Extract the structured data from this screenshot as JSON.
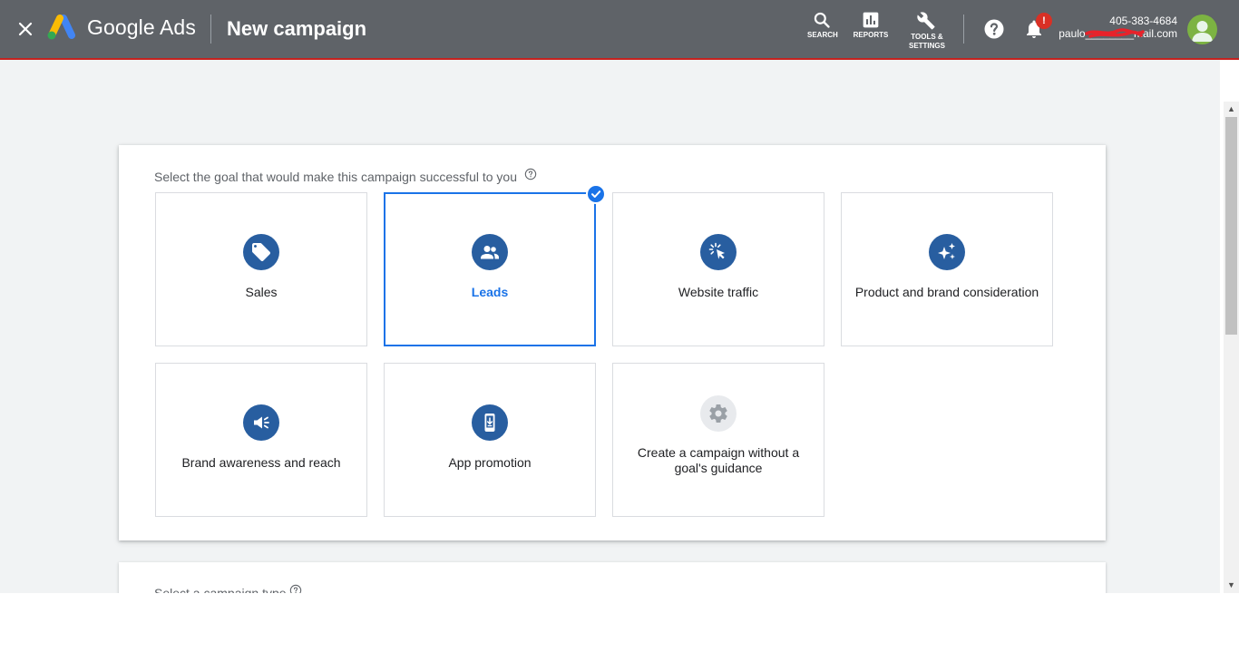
{
  "header": {
    "brand": "Google Ads",
    "title": "New campaign",
    "tools": {
      "search": "SEARCH",
      "reports": "REPORTS",
      "tools_line1": "TOOLS &",
      "tools_line2": "SETTINGS"
    },
    "notification_badge": "!",
    "account_phone": "405-383-4684",
    "account_email": "paulo________mail.com"
  },
  "goal_section": {
    "prompt": "Select the goal that would make this campaign successful to you",
    "goals": [
      {
        "label": "Sales",
        "icon": "tag-icon",
        "selected": false
      },
      {
        "label": "Leads",
        "icon": "people-icon",
        "selected": true
      },
      {
        "label": "Website traffic",
        "icon": "cursor-click-icon",
        "selected": false
      },
      {
        "label": "Product and brand consideration",
        "icon": "sparkle-icon",
        "selected": false
      },
      {
        "label": "Brand awareness and reach",
        "icon": "megaphone-icon",
        "selected": false
      },
      {
        "label": "App promotion",
        "icon": "phone-download-icon",
        "selected": false
      },
      {
        "label": "Create a campaign without a goal's guidance",
        "icon": "gear-icon",
        "selected": false
      }
    ]
  },
  "type_section": {
    "prompt": "Select a campaign type"
  },
  "colors": {
    "topbar": "#5f6368",
    "accent": "#1a73e8",
    "icon_circle": "#285ea0",
    "background": "#f1f3f4"
  }
}
